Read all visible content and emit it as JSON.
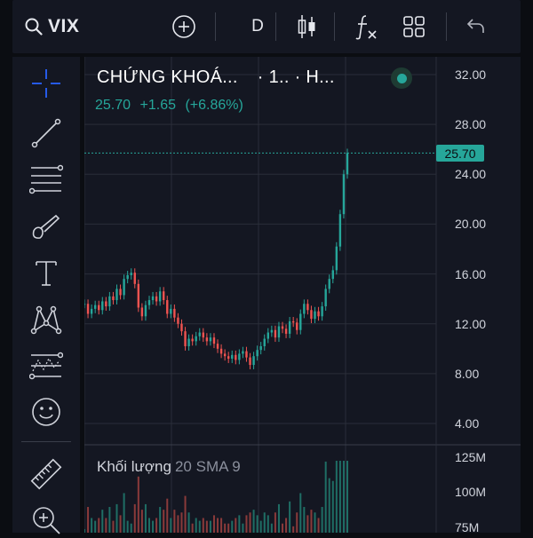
{
  "topbar": {
    "symbol": "VIX",
    "interval": "D",
    "icons": [
      "search-icon",
      "add-icon",
      "candles-icon",
      "indicators-icon",
      "layouts-icon",
      "undo-icon"
    ]
  },
  "sidebar": {
    "tools": [
      "crosshair-icon",
      "trendline-icon",
      "fib-icon",
      "brush-icon",
      "text-icon",
      "pattern-icon",
      "prediction-icon",
      "emoji-icon",
      "ruler-icon",
      "zoom-in-icon"
    ]
  },
  "legend": {
    "title": "CHỨNG KHOÁ...",
    "interval": "· 1.. · H...",
    "last": "25.70",
    "change": "+1.65",
    "change_pct": "(+6.86%)",
    "status_color": "#26a69a"
  },
  "price_axis": {
    "labels": [
      "32.00",
      "28.00",
      "24.00",
      "20.00",
      "16.00",
      "12.00",
      "8.00",
      "4.00"
    ],
    "last_price_tag": "25.70"
  },
  "volume_pane": {
    "title": "Khối lượng",
    "indicator": "20 SMA 9",
    "axis_labels": [
      "125M",
      "100M",
      "75M"
    ]
  },
  "chart_data": {
    "type": "line",
    "title": "",
    "xlabel": "",
    "ylabel": "",
    "ylim": [
      0,
      34
    ],
    "series": [
      {
        "values": [
          13.6,
          12.8,
          13.2,
          13.5,
          13.1,
          13.8,
          13.4,
          14.2,
          13.9,
          14.8,
          14.3,
          15.6,
          15.9,
          16.1,
          15.2,
          13.3,
          12.6,
          13.5,
          13.9,
          14.2,
          13.8,
          14.6,
          13.9,
          12.8,
          13.2,
          12.5,
          12.0,
          11.4,
          10.2,
          10.8,
          10.6,
          11.0,
          11.3,
          10.9,
          10.6,
          10.9,
          10.4,
          10.0,
          9.6,
          9.4,
          9.2,
          9.5,
          9.1,
          9.6,
          9.8,
          9.3,
          8.7,
          9.4,
          9.9,
          10.2,
          10.8,
          11.3,
          11.5,
          10.9,
          11.8,
          11.6,
          11.2,
          12.2,
          12.1,
          11.5,
          12.8,
          13.6,
          13.1,
          12.4,
          13.0,
          12.6,
          13.4,
          14.8,
          15.6,
          16.3,
          18.2,
          20.8,
          24.0,
          25.7
        ]
      }
    ],
    "volume_max": 125
  }
}
